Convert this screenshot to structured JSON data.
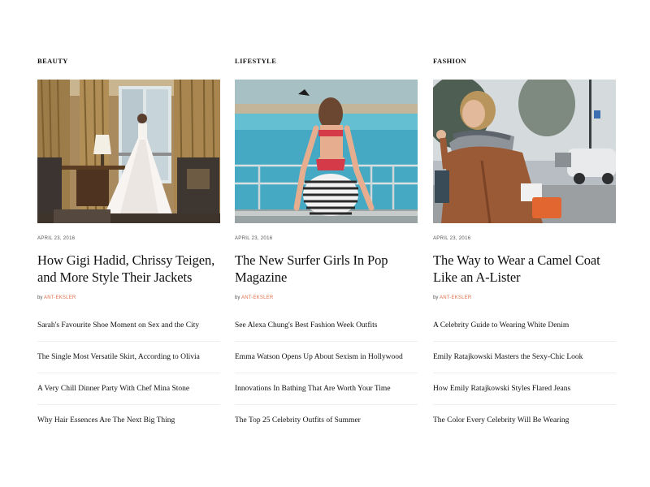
{
  "columns": [
    {
      "category": "BEAUTY",
      "image": "bride-white-gown-hotel-room",
      "date": "APRIL 23, 2016",
      "headline": "How Gigi Hadid, Chrissy Teigen, and More Style Their Jackets",
      "by": "by",
      "author": "ANT-EKSLER",
      "links": [
        "Sarah's Favourite Shoe Moment on Sex and the City",
        "The Single Most Versatile Skirt, According to Olivia",
        "A Very Chill Dinner Party With Chef Mina Stone",
        "Why Hair Essences Are The Next Big Thing"
      ]
    },
    {
      "category": "LIFESTYLE",
      "image": "woman-striped-swimsuit-pool",
      "date": "APRIL 23, 2016",
      "headline": "The New Surfer Girls In Pop Magazine",
      "by": "by",
      "author": "ANT-EKSLER",
      "links": [
        "See Alexa Chung's Best Fashion Week Outfits",
        "Emma Watson Opens Up About Sexism in Hollywood",
        "Innovations In Bathing That Are Worth Your Time",
        "The Top 25 Celebrity Outfits of Summer"
      ]
    },
    {
      "category": "FASHION",
      "image": "woman-camel-coat-street",
      "date": "APRIL 23, 2016",
      "headline": "The Way to Wear a Camel Coat Like an A-Lister",
      "by": "by",
      "author": "ANT-EKSLER",
      "links": [
        "A Celebrity Guide to Wearing White Denim",
        "Emily Ratajkowski Masters the Sexy-Chic Look",
        "How Emily Ratajkowski Styles Flared Jeans",
        "The Color Every Celebrity Will Be Wearing"
      ]
    }
  ]
}
